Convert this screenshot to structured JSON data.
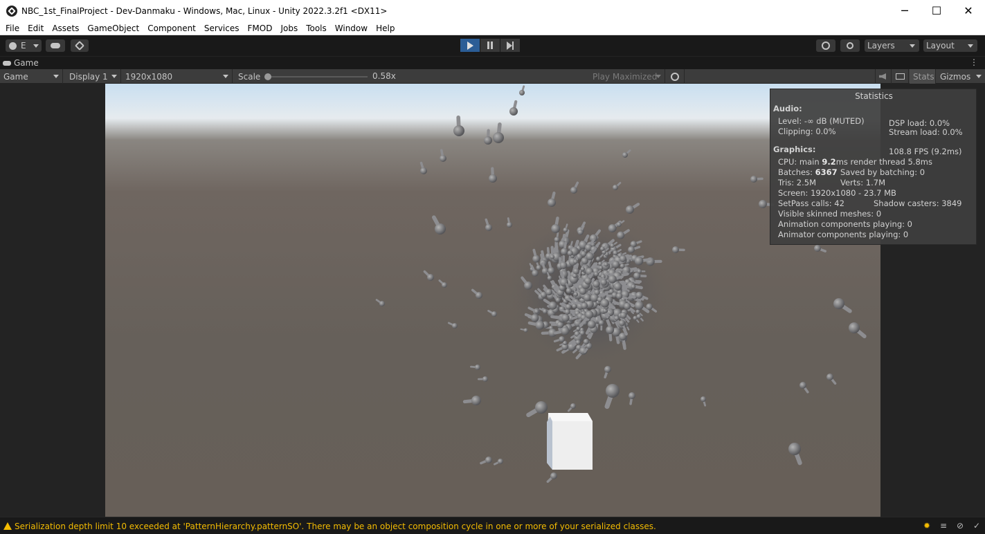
{
  "window": {
    "title": "NBC_1st_FinalProject - Dev-Danmaku - Windows, Mac, Linux - Unity 2022.3.2f1 <DX11>",
    "minimize": "─",
    "maximize": "☐",
    "close": "✕"
  },
  "menu": [
    "File",
    "Edit",
    "Assets",
    "GameObject",
    "Component",
    "Services",
    "FMOD",
    "Jobs",
    "Tools",
    "Window",
    "Help"
  ],
  "toolbar": {
    "account_label": "E",
    "layers_label": "Layers",
    "layout_label": "Layout"
  },
  "tab": {
    "label": "Game"
  },
  "game_toolbar": {
    "view_mode": "Game",
    "display": "Display 1",
    "resolution": "1920x1080",
    "scale_label": "Scale",
    "scale_value": "0.58x",
    "play_mode": "Play Maximized",
    "stats_label": "Stats",
    "gizmos_label": "Gizmos"
  },
  "stats": {
    "title": "Statistics",
    "audio_header": "Audio:",
    "level": "Level: -∞ dB (MUTED)",
    "clipping": "Clipping: 0.0%",
    "dsp_load": "DSP load: 0.0%",
    "stream_load": "Stream load: 0.0%",
    "graphics_header": "Graphics:",
    "fps": "108.8 FPS (9.2ms)",
    "cpu_prefix": "CPU: main ",
    "cpu_main": "9.2",
    "cpu_suffix": "ms  render thread 5.8ms",
    "batches_prefix": "Batches: ",
    "batches_value": "6367",
    "saved_by_batching": "Saved by batching: 0",
    "tris": "Tris: 2.5M",
    "verts": "Verts: 1.7M",
    "screen": "Screen: 1920x1080 - 23.7 MB",
    "setpass": "SetPass calls: 42",
    "shadow_casters": "Shadow casters: 3849",
    "skinned": "Visible skinned meshes: 0",
    "animation": "Animation components playing: 0",
    "animator": "Animator components playing: 0"
  },
  "status": {
    "message": "Serialization depth limit 10 exceeded at 'PatternHierarchy.patternSO'. There may be an object composition cycle in one or more of your serialized classes."
  }
}
